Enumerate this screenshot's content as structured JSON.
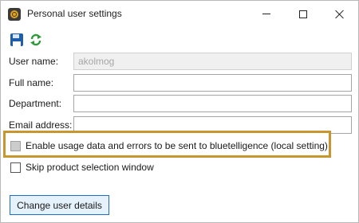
{
  "window": {
    "title": "Personal user settings",
    "app_icon": "bluetelligence-logo-icon",
    "controls": [
      "minimize-icon",
      "maximize-icon",
      "close-icon"
    ]
  },
  "toolbar": {
    "icons": [
      "save-icon",
      "refresh-icon"
    ]
  },
  "form": {
    "user_name": {
      "label": "User name:",
      "value": "akolmog",
      "enabled": false
    },
    "full_name": {
      "label": "Full name:",
      "value": ""
    },
    "department": {
      "label": "Department:",
      "value": ""
    },
    "email": {
      "label": "Email address:",
      "value": ""
    }
  },
  "options": {
    "usage_data": {
      "label": "Enable usage data and errors to be sent to bluetelligence (local setting)",
      "checked": false
    },
    "skip_product_selection": {
      "label": "Skip product selection window",
      "checked": false
    }
  },
  "actions": {
    "change_user_details": "Change user details"
  },
  "colors": {
    "highlight_border": "#c8962f",
    "button_border": "#1e6cc6",
    "button_bg": "#e5f1fb"
  }
}
